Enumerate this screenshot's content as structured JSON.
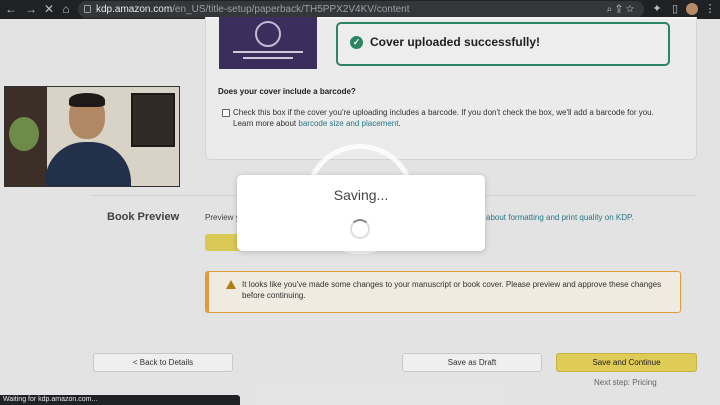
{
  "browser": {
    "url_host": "kdp.amazon.com",
    "url_path": "/en_US/title-setup/paperback/TH5PPX2V4KV/content",
    "status": "Waiting for kdp.amazon.com..."
  },
  "cover_card": {
    "success_message": "Cover uploaded successfully!",
    "barcode_question": "Does your cover include a barcode?",
    "barcode_text": "Check this box if the cover you're uploading includes a barcode. If you don't check the box, we'll add a barcode for you. Learn more about ",
    "barcode_link": "barcode size and placement",
    "barcode_suffix": "."
  },
  "book_preview": {
    "heading": "Book Preview",
    "preview_text": "Preview y",
    "link_text": "about formatting and print quality on KDP.",
    "warning_text": "It looks like you've made some changes to your manuscript or book cover. Please preview and approve these changes before continuing."
  },
  "modal": {
    "title": "Saving..."
  },
  "footer": {
    "back_label": "< Back to Details",
    "draft_label": "Save as Draft",
    "continue_label": "Save and Continue",
    "next_step": "Next step: Pricing"
  },
  "colors": {
    "success": "#2d8a67",
    "accent_yellow": "#e7d25a",
    "warning": "#e7a23b",
    "link": "#2a7c8a"
  }
}
